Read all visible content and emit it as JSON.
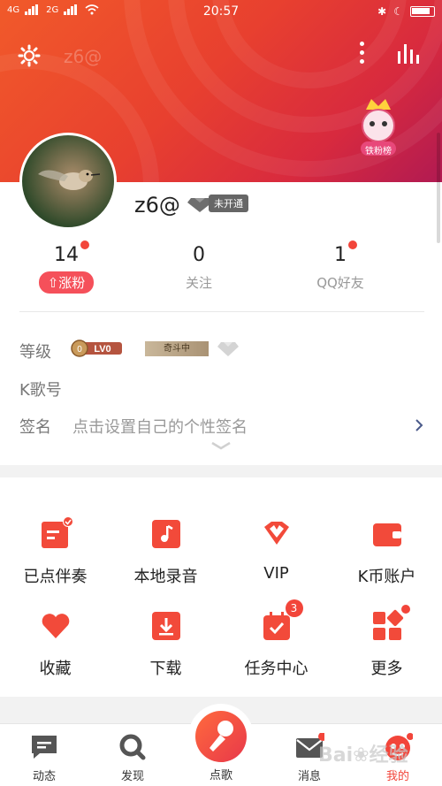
{
  "status_bar": {
    "signal_1": "4G",
    "signal_2": "2G",
    "time": "20:57"
  },
  "header": {
    "ghost_name": "z6@"
  },
  "profile": {
    "username": "z6@",
    "vip_status": "未开通",
    "stats": [
      {
        "value": "14",
        "action": "⇧涨粉"
      },
      {
        "value": "0",
        "label": "关注"
      },
      {
        "value": "1",
        "label": "QQ好友"
      }
    ],
    "level_label": "等级",
    "level_value": "LV0",
    "qidou_label": "奇斗中",
    "kge_label": "K歌号",
    "sign_label": "签名",
    "sign_placeholder": "点击设置自己的个性签名"
  },
  "grid": [
    {
      "label": "已点伴奏",
      "icon": "accompaniment-icon"
    },
    {
      "label": "本地录音",
      "icon": "local-recording-icon"
    },
    {
      "label": "VIP",
      "icon": "vip-icon"
    },
    {
      "label": "K币账户",
      "icon": "wallet-icon"
    },
    {
      "label": "收藏",
      "icon": "heart-icon"
    },
    {
      "label": "下载",
      "icon": "download-icon"
    },
    {
      "label": "任务中心",
      "icon": "task-icon",
      "badge": "3"
    },
    {
      "label": "更多",
      "icon": "more-grid-icon"
    }
  ],
  "tabbar": [
    {
      "label": "动态",
      "icon": "chat-icon"
    },
    {
      "label": "发现",
      "icon": "search-icon"
    },
    {
      "label": "点歌",
      "icon": "mic-icon"
    },
    {
      "label": "消息",
      "icon": "mail-icon"
    },
    {
      "label": "我的",
      "icon": "profile-icon",
      "active": true
    }
  ],
  "fan_badge": "铁粉榜",
  "colors": {
    "accent": "#f2453a",
    "header_start": "#f15a2a",
    "header_end": "#b11a52"
  }
}
